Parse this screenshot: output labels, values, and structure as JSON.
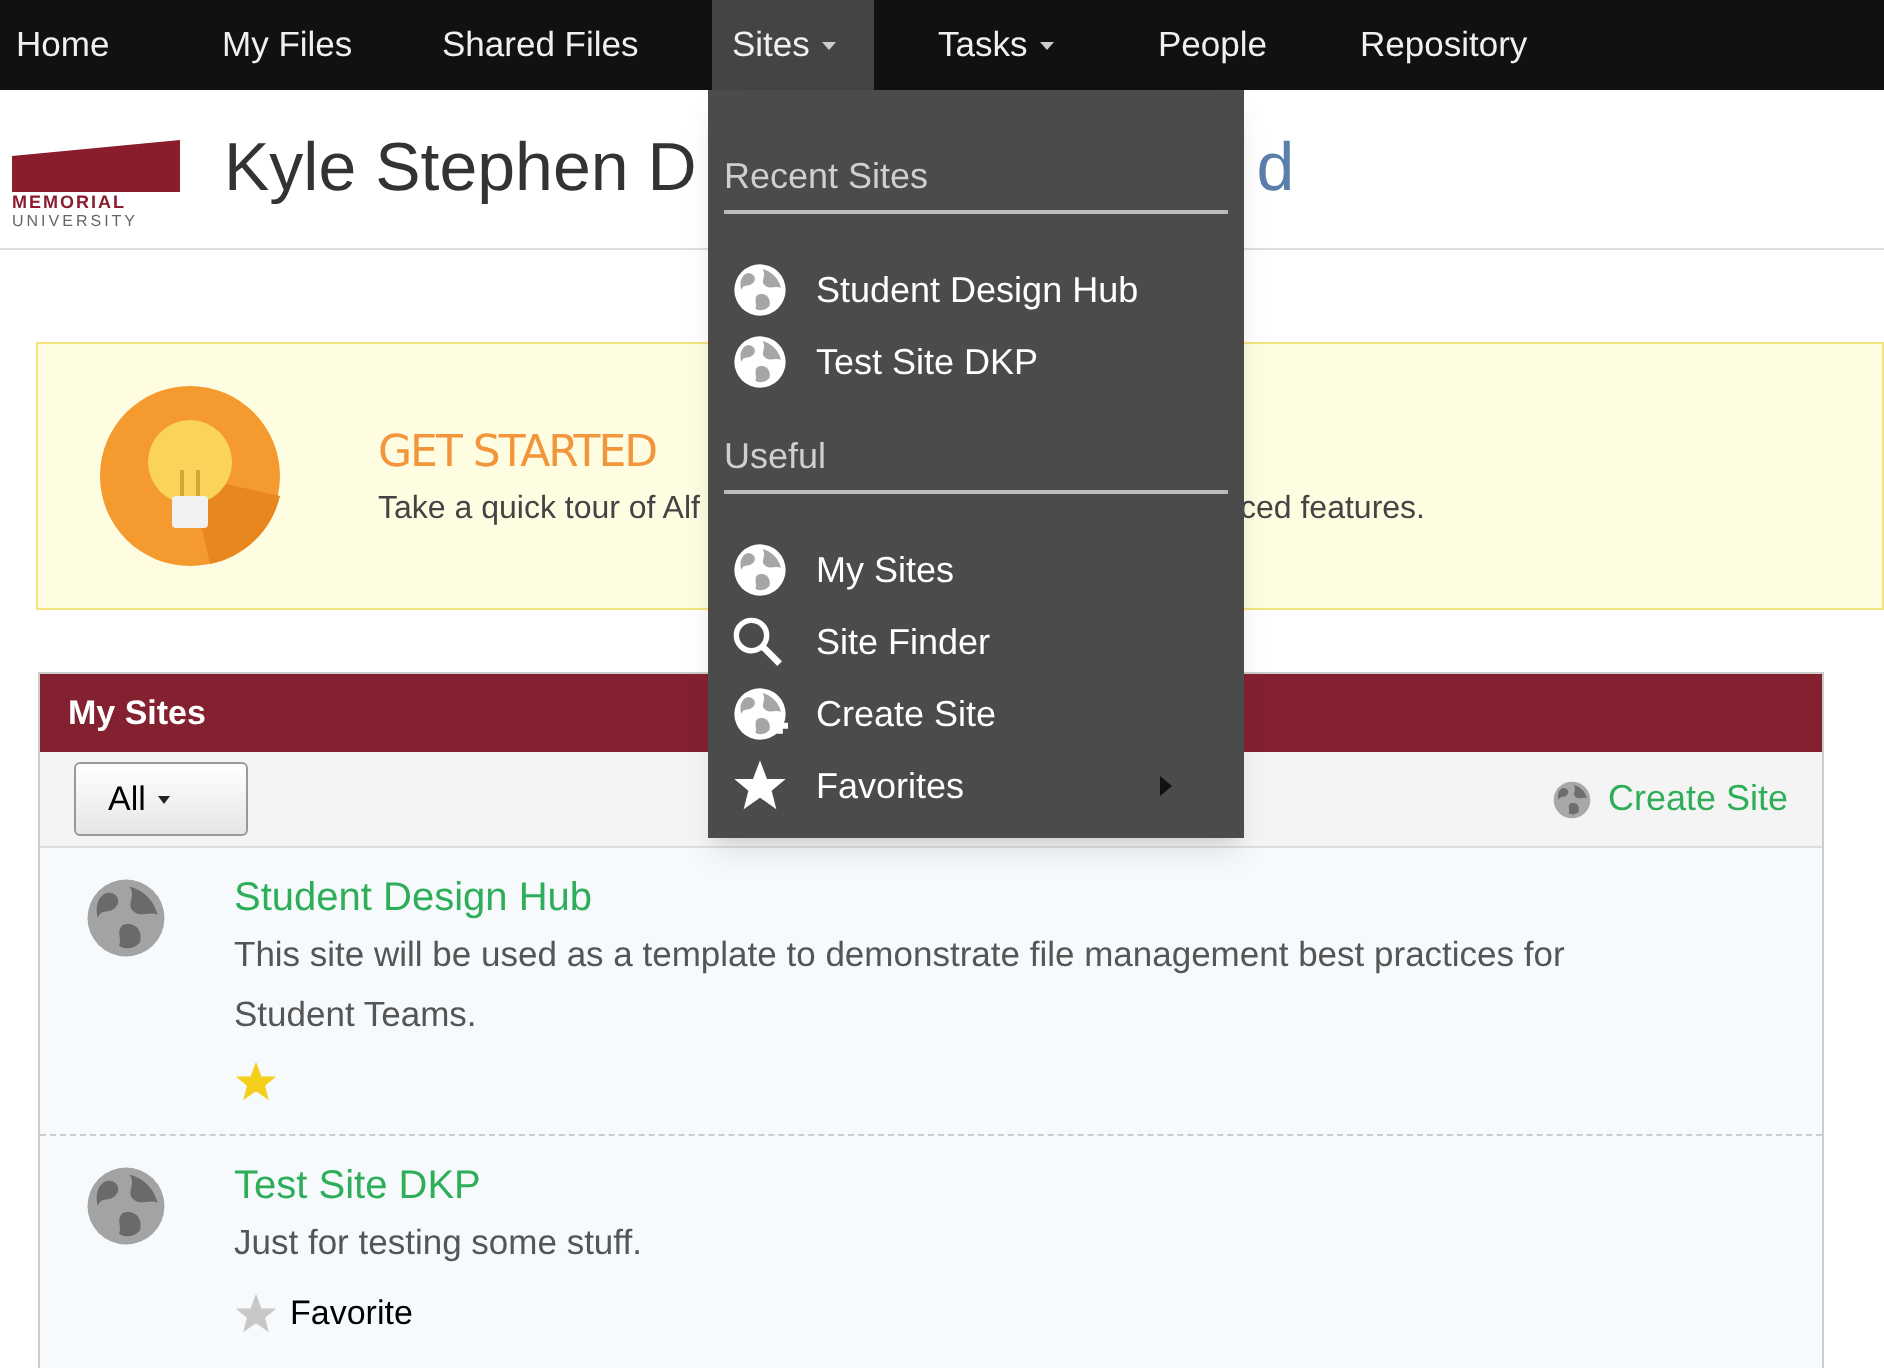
{
  "nav": [
    {
      "label": "Home",
      "selected": false,
      "dropdown": false
    },
    {
      "label": "My Files",
      "selected": false,
      "dropdown": false
    },
    {
      "label": "Shared Files",
      "selected": false,
      "dropdown": false
    },
    {
      "label": "Sites",
      "selected": true,
      "dropdown": true
    },
    {
      "label": "Tasks",
      "selected": false,
      "dropdown": true
    },
    {
      "label": "People",
      "selected": false,
      "dropdown": false
    },
    {
      "label": "Repository",
      "selected": false,
      "dropdown": false
    }
  ],
  "sites_menu": {
    "sections": [
      {
        "heading": "Recent Sites",
        "items": [
          {
            "label": "Student Design Hub",
            "kind": "globe",
            "submenu": false
          },
          {
            "label": "Test Site DKP",
            "kind": "globe",
            "submenu": false
          }
        ]
      },
      {
        "heading": "Useful",
        "items": [
          {
            "label": "My Sites",
            "kind": "globe",
            "submenu": false
          },
          {
            "label": "Site Finder",
            "kind": "search",
            "submenu": false
          },
          {
            "label": "Create Site",
            "kind": "globe-plus",
            "submenu": false
          },
          {
            "label": "Favorites",
            "kind": "star",
            "submenu": true
          }
        ]
      }
    ]
  },
  "header": {
    "logo_lines": [
      "MEMORIAL",
      "UNIVERSITY"
    ],
    "title_parts": [
      "Kyle Stephen D",
      "d"
    ]
  },
  "get_started": {
    "heading": "GET STARTED",
    "text_parts": [
      "Take a quick tour of Alf",
      "ced features."
    ]
  },
  "my_sites": {
    "title": "My Sites",
    "filter": "All",
    "create_link": "Create Site",
    "sites": [
      {
        "name": "Student Design Hub",
        "description": "This site will be used as a template to demonstrate file management best practices for Student Teams.",
        "favorite": true
      },
      {
        "name": "Test Site DKP",
        "description": "Just for testing some stuff.",
        "favorite": false,
        "favorite_label": "Favorite"
      }
    ]
  }
}
